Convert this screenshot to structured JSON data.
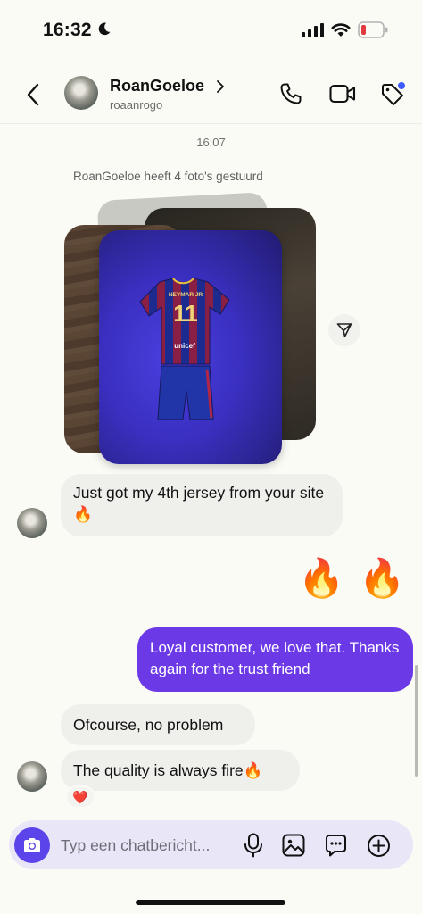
{
  "status_bar": {
    "time": "16:32"
  },
  "header": {
    "name": "RoanGoeloe",
    "username": "roaanrogo"
  },
  "conversation": {
    "timestamp": "16:07",
    "system_note": "RoanGoeloe heeft 4 foto's gestuurd",
    "jersey_print": {
      "name": "NEYMAR JR",
      "number": "11",
      "sponsor": "unicef"
    },
    "messages": [
      {
        "id": "m1",
        "direction": "incoming",
        "text": "Just got my 4th jersey from your site🔥"
      },
      {
        "id": "m2",
        "direction": "outgoing",
        "text": "🔥"
      },
      {
        "id": "m3",
        "direction": "outgoing",
        "text": "🔥"
      },
      {
        "id": "m4",
        "direction": "outgoing",
        "text": "Loyal customer, we love that. Thanks again for the trust friend"
      },
      {
        "id": "m5",
        "direction": "incoming",
        "text": "Ofcourse, no problem"
      },
      {
        "id": "m6",
        "direction": "incoming",
        "text": "The quality is always fire🔥",
        "reaction": "❤️"
      }
    ]
  },
  "composer": {
    "placeholder": "Typ een chatbericht..."
  },
  "colors": {
    "accent": "#6c39e6",
    "camera_button": "#5b45ea",
    "incoming_bubble": "#efefec",
    "notification_dot": "#3b5bfd"
  },
  "icons": [
    "moon-icon",
    "signal-icon",
    "wifi-icon",
    "battery-icon",
    "back-icon",
    "chevron-right-icon",
    "phone-icon",
    "video-icon",
    "tag-icon",
    "share-icon",
    "camera-icon",
    "mic-icon",
    "image-icon",
    "sticker-icon",
    "plus-icon"
  ]
}
